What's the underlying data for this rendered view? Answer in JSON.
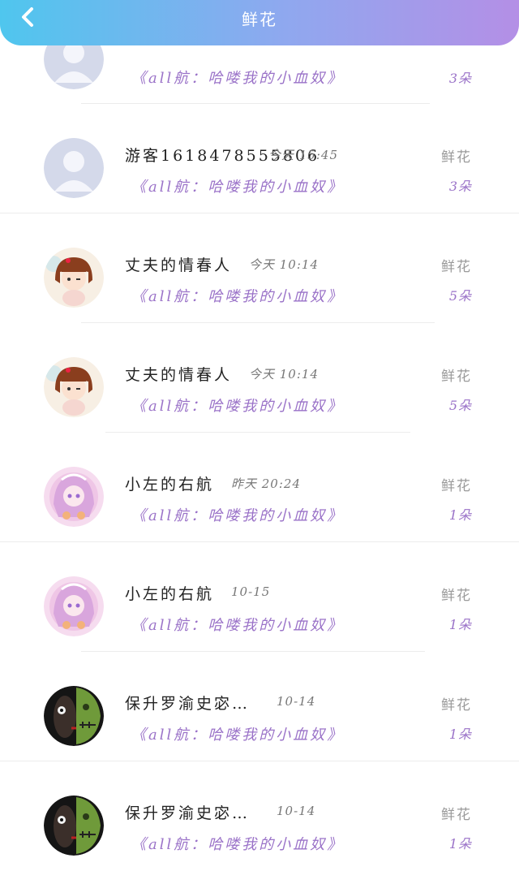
{
  "header": {
    "title": "鲜花"
  },
  "items": [
    {
      "avatar": "default-avatar",
      "name": "",
      "time": "",
      "book": "《all航：哈喽我的小血奴》",
      "gift_label": "",
      "gift_count": "3朵"
    },
    {
      "avatar": "default-avatar",
      "name": "游客1618478555806",
      "time": "今天 15:45",
      "book": "《all航：哈喽我的小血奴》",
      "gift_label": "鲜花",
      "gift_count": "3朵"
    },
    {
      "avatar": "cartoon-girl-avatar",
      "name": "丈夫的情春人",
      "time": "今天 10:14",
      "book": "《all航：哈喽我的小血奴》",
      "gift_label": "鲜花",
      "gift_count": "5朵"
    },
    {
      "avatar": "cartoon-girl-avatar",
      "name": "丈夫的情春人",
      "time": "今天 10:14",
      "book": "《all航：哈喽我的小血奴》",
      "gift_label": "鲜花",
      "gift_count": "5朵"
    },
    {
      "avatar": "anime-girl-avatar",
      "name": "小左的右航",
      "time": "昨天 20:24",
      "book": "《all航：哈喽我的小血奴》",
      "gift_label": "鲜花",
      "gift_count": "1朵"
    },
    {
      "avatar": "anime-girl-avatar",
      "name": "小左的右航",
      "time": "10-15",
      "book": "《all航：哈喽我的小血奴》",
      "gift_label": "鲜花",
      "gift_count": "1朵"
    },
    {
      "avatar": "zombie-face-avatar",
      "name": "保升罗渝史宓…",
      "time": "10-14",
      "book": "《all航：哈喽我的小血奴》",
      "gift_label": "鲜花",
      "gift_count": "1朵"
    },
    {
      "avatar": "zombie-face-avatar",
      "name": "保升罗渝史宓…",
      "time": "10-14",
      "book": "《all航：哈喽我的小血奴》",
      "gift_label": "鲜花",
      "gift_count": "1朵"
    }
  ]
}
